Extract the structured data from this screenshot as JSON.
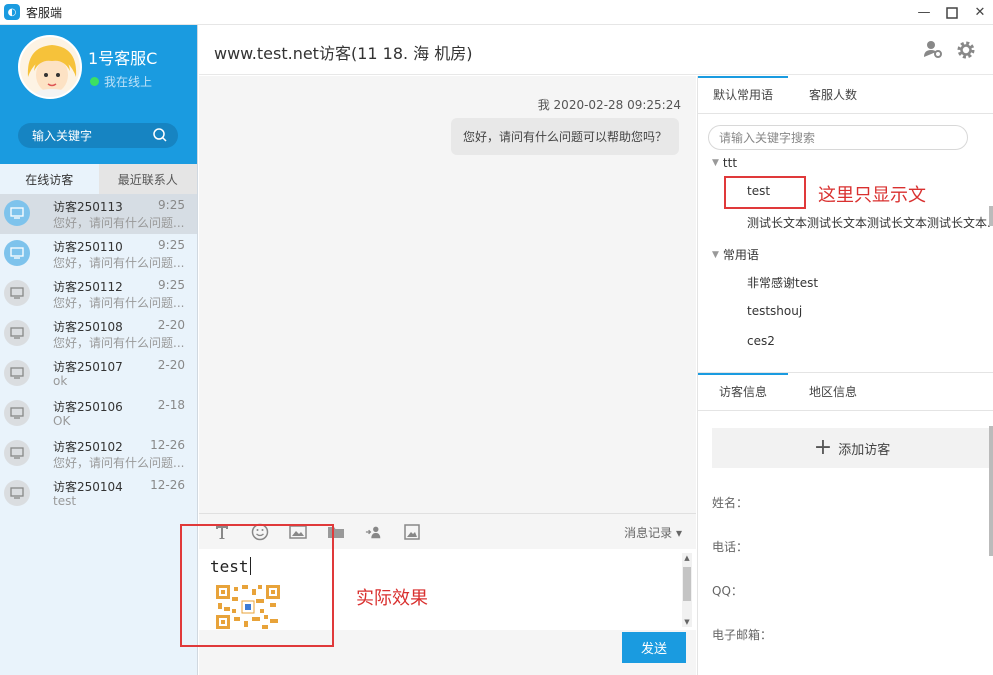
{
  "window": {
    "title": "客服端"
  },
  "agent": {
    "name": "1号客服C",
    "status": "我在线上"
  },
  "sidebar": {
    "search_placeholder": "输入关键字",
    "tabs": [
      {
        "label": "在线访客"
      },
      {
        "label": "最近联系人"
      }
    ],
    "visitors": [
      {
        "name": "访客250113",
        "time": "9:25",
        "message": "您好，请问有什么问题..."
      },
      {
        "name": "访客250110",
        "time": "9:25",
        "message": "您好，请问有什么问题..."
      },
      {
        "name": "访客250112",
        "time": "9:25",
        "message": "您好，请问有什么问题..."
      },
      {
        "name": "访客250108",
        "time": "2-20",
        "message": "您好，请问有什么问题..."
      },
      {
        "name": "访客250107",
        "time": "2-20",
        "message": "ok"
      },
      {
        "name": "访客250106",
        "time": "2-18",
        "message": "OK"
      },
      {
        "name": "访客250102",
        "time": "12-26",
        "message": "您好，请问有什么问题..."
      },
      {
        "name": "访客250104",
        "time": "12-26",
        "message": "test"
      }
    ]
  },
  "chat": {
    "title": "www.test.net访客(11                 18.       海        机房)",
    "messages": [
      {
        "sender_time": "我 2020-02-28 09:25:24",
        "text": "您好，请问有什么问题可以帮助您吗？"
      }
    ],
    "history_label": "消息记录",
    "input_text": "test",
    "send_label": "发送"
  },
  "annotations": {
    "left": "实际效果",
    "right": "这里只显示文"
  },
  "right_panel": {
    "tabs": [
      {
        "label": "默认常用语"
      },
      {
        "label": "客服人数"
      }
    ],
    "search_placeholder": "请输入关键字搜索",
    "groups": [
      {
        "name": "ttt",
        "items": [
          "test",
          "测试长文本测试长文本测试长文本测试长文本..."
        ]
      },
      {
        "name": "常用语",
        "items": [
          "非常感谢test",
          "testshouj",
          "ces2"
        ]
      }
    ],
    "bottom_tabs": [
      {
        "label": "访客信息"
      },
      {
        "label": "地区信息"
      }
    ],
    "add_visitor_label": "添加访客",
    "fields": [
      "姓名：",
      "电话：",
      "QQ：",
      "电子邮箱："
    ]
  }
}
